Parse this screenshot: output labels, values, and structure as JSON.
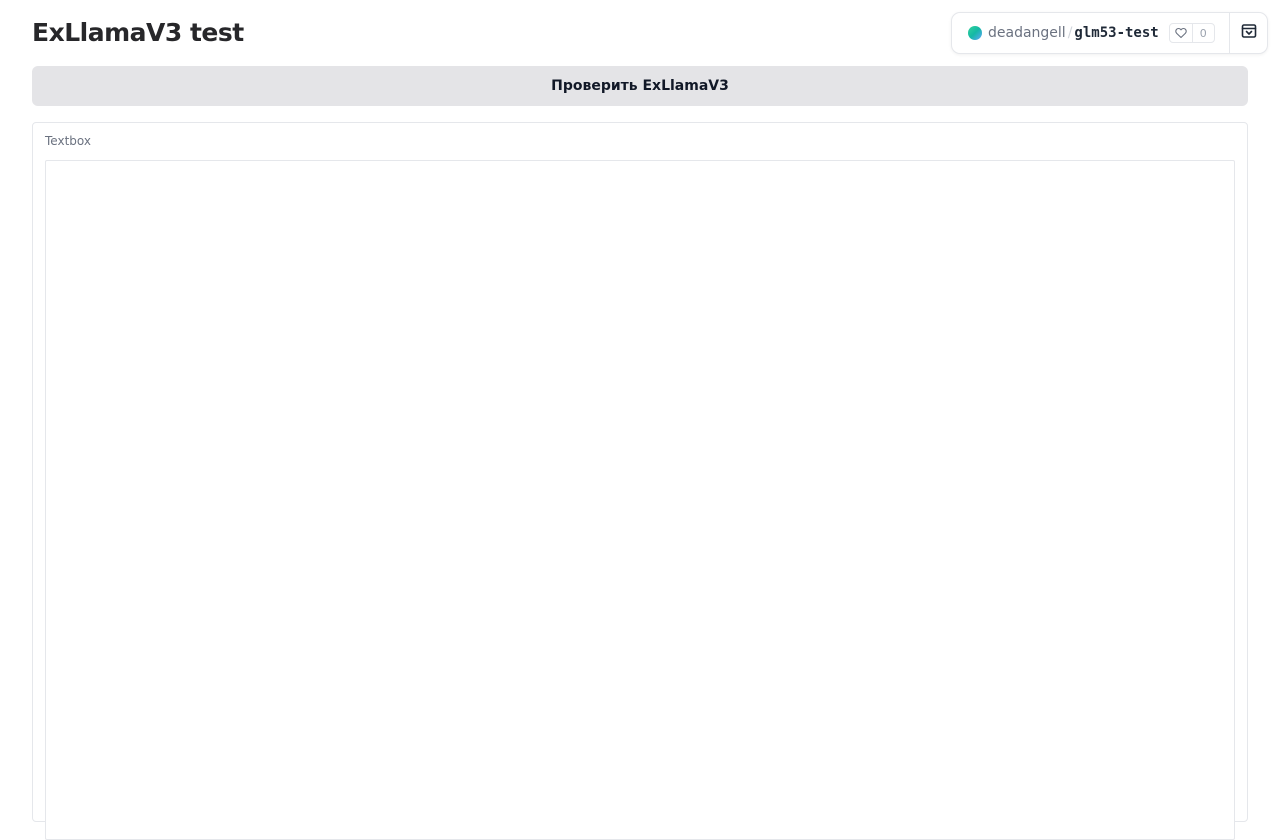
{
  "page": {
    "title": "ExLlamaV3 test"
  },
  "space_header": {
    "owner": "deadangell",
    "separator": "/",
    "name": "glm53-test",
    "likes": "0",
    "icons": {
      "avatar": "space-avatar-icon",
      "like": "heart-icon",
      "collapse": "collapse-header-icon"
    },
    "colors": {
      "avatar_gradient": [
        "#34d399",
        "#14b8a6",
        "#60a5fa"
      ]
    }
  },
  "actions": {
    "check_button_label": "Проверить ExLlamaV3"
  },
  "output": {
    "label": "Textbox",
    "value": "",
    "placeholder": ""
  },
  "colors": {
    "button_bg": "#e4e4e7",
    "border": "#e5e7eb",
    "label": "#6b7280"
  }
}
